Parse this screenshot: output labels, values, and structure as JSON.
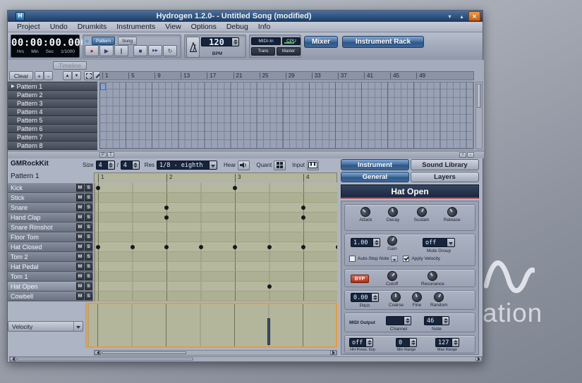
{
  "desktop": {
    "watermark_text": "ation"
  },
  "window": {
    "title": "Hydrogen 1.2.0- - Untitled Song (modified)",
    "app_initial": "H",
    "minimize_glyph": "▾",
    "maximize_glyph": "▴",
    "close_glyph": "✕"
  },
  "menu": {
    "items": [
      "Project",
      "Undo",
      "Drumkits",
      "Instruments",
      "View",
      "Options",
      "Debug",
      "Info"
    ]
  },
  "toolbar": {
    "time_value": "00:00:00.000",
    "time_units": [
      "Hrs",
      "Min",
      "Sec",
      "1/1000"
    ],
    "mode_pattern": "Pattern",
    "mode_song": "Song",
    "transport_buttons": [
      {
        "name": "record",
        "glyph": "●"
      },
      {
        "name": "play",
        "glyph": "▶"
      },
      {
        "name": "pause",
        "glyph": "∥"
      },
      {
        "name": "stop",
        "glyph": "■"
      },
      {
        "name": "fast-forward",
        "glyph": "▶▶"
      },
      {
        "name": "loop",
        "glyph": "↻"
      }
    ],
    "bpm_value": "120",
    "bpm_label": "BPM",
    "midi_in_label": "MIDI-In",
    "cpu_label": "CPU",
    "trans_label": "Trans",
    "master_label": "Master",
    "mixer_label": "Mixer",
    "instrument_rack_label": "Instrument Rack"
  },
  "song_editor": {
    "timeline_label": "Timeline",
    "clear_label": "Clear",
    "plus_glyph": "+",
    "minus_glyph": "-",
    "up_glyph": "▲",
    "down_glyph": "▼",
    "play_marker_glyph": "▶",
    "ruler_ticks": [
      "1",
      "5",
      "9",
      "13",
      "17",
      "21",
      "25",
      "29",
      "33",
      "37",
      "41",
      "45",
      "49"
    ],
    "patterns": [
      "Pattern 1",
      "Pattern 2",
      "Pattern 3",
      "Pattern 4",
      "Pattern 5",
      "Pattern 6",
      "Pattern 7",
      "Pattern 8"
    ],
    "active_cell": {
      "row": 0,
      "col": 0
    },
    "footer_buttons": [
      "P",
      "T"
    ]
  },
  "pattern_editor": {
    "kit_name": "GMRockKit",
    "pattern_name": "Pattern 1",
    "size_label": "Size",
    "size_num": "4",
    "size_sep": "/",
    "size_den": "4",
    "res_label": "Res",
    "res_value": "1/8 - eighth",
    "hear_label": "Hear",
    "quant_label": "Quant",
    "input_label": "Input",
    "mute_label": "M",
    "solo_label": "S",
    "ruler_ticks": [
      "1",
      "2",
      "3",
      "4"
    ],
    "velocity_selector": "Velocity",
    "instruments": [
      "Kick",
      "Stick",
      "Snare",
      "Hand Clap",
      "Snare Rimshot",
      "Floor Tom",
      "Hat Closed",
      "Tom 2",
      "Hat Pedal",
      "Tom 1",
      "Hat Open",
      "Cowbell"
    ],
    "selected_instrument": "Hat Open",
    "notes": [
      {
        "instrument": "Kick",
        "row": 0,
        "beats": [
          0,
          2
        ]
      },
      {
        "instrument": "Snare",
        "row": 2,
        "beats": [
          1,
          3
        ]
      },
      {
        "instrument": "Hand Clap",
        "row": 3,
        "beats": [
          1,
          3
        ]
      },
      {
        "instrument": "Hat Closed",
        "row": 6,
        "beats": [
          0,
          0.5,
          1,
          1.5,
          2,
          2.5,
          3,
          3.5
        ]
      },
      {
        "instrument": "Hat Open",
        "row": 10,
        "beats": [
          2.5
        ]
      }
    ],
    "velocity_bars": [
      {
        "beat": 2.5,
        "value": 0.68
      }
    ]
  },
  "instrument_panel": {
    "tabs": [
      {
        "label": "Instrument",
        "active": true
      },
      {
        "label": "Sound Library",
        "active": false
      }
    ],
    "subtabs": [
      {
        "label": "General",
        "active": true
      },
      {
        "label": "Layers",
        "active": false
      }
    ],
    "instrument_name": "Hat Open",
    "adsr_knobs": [
      "Attack",
      "Decay",
      "Sustain",
      "Release"
    ],
    "gain_value": "1.00",
    "gain_label": "Gain",
    "mute_group_value": "off",
    "mute_group_label": "Mute Group",
    "auto_stop_label": "Auto-Stop Note",
    "apply_velocity_label": "Apply Velocity",
    "bypass_label": "BYP",
    "cutoff_label": "Cutoff",
    "resonance_label": "Resonance",
    "pitch_value": "0.00",
    "pitch_label": "Pitch",
    "pitch_knobs": [
      "Coarse",
      "Fine",
      "Random"
    ],
    "midi_output_label": "MIDI Output",
    "channel_label": "Channel",
    "note_value": "46",
    "note_label": "Note",
    "hh_press_value": "off",
    "hh_press_label": "HH Press. Grp",
    "min_range_value": "0",
    "min_range_label": "Min Range",
    "max_range_value": "127",
    "max_range_label": "Max Range"
  }
}
